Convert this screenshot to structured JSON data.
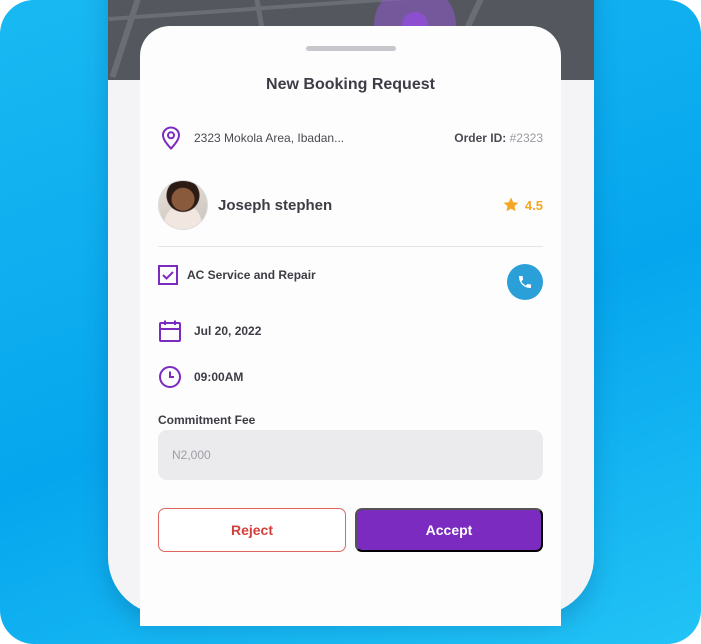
{
  "sheet": {
    "title": "New Booking Request",
    "address": "2323 Mokola Area, Ibadan...",
    "order_label": "Order ID:",
    "order_id": "#2323"
  },
  "customer": {
    "name": "Joseph stephen",
    "rating": "4.5"
  },
  "details": {
    "service": "AC Service and Repair",
    "date": "Jul 20, 2022",
    "time": "09:00AM"
  },
  "fee": {
    "label": "Commitment Fee",
    "value": "N2,000"
  },
  "actions": {
    "reject_label": "Reject",
    "accept_label": "Accept"
  },
  "colors": {
    "accent": "#7b2bbf",
    "reject": "#d33f3a",
    "rating": "#f5a623",
    "call": "#2a9fd8",
    "background": "#06a6ee"
  },
  "icons": {
    "location": "location-pin-icon",
    "star": "star-icon",
    "check": "checkbox-icon",
    "phone": "phone-icon",
    "calendar": "calendar-icon",
    "clock": "clock-icon"
  }
}
